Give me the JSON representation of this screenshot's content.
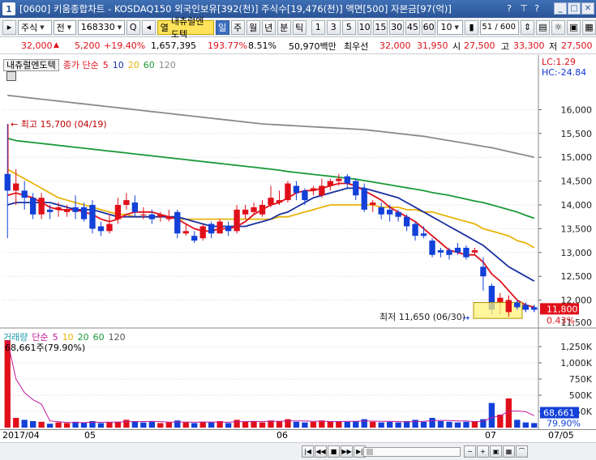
{
  "window": {
    "number": "1",
    "title": "[0600] 키움종합차트 - KOSDAQ150 외국인보유[392(천)] 주식수[19,476(천)] 액면[500] 자본금[97(억)]"
  },
  "toolbar": {
    "market": "주식",
    "scope": "전",
    "code": "168330",
    "stock_name": "내츄럴엔도텍",
    "periods": [
      "일",
      "주",
      "월",
      "년",
      "분",
      "틱"
    ],
    "active_period": "일",
    "minutes": [
      "1",
      "3",
      "5",
      "10",
      "15",
      "30",
      "45",
      "60"
    ],
    "count_value": "10",
    "page_counter": "51 / 600"
  },
  "price_strip": {
    "price": "32,000",
    "change": "5,200",
    "change_pct": "+19.40%",
    "volume": "1,657,395",
    "vol_ratio": "193.77%",
    "turnover": "8.51%",
    "amount": "50,970백만",
    "best_ask_label": "최우선",
    "best_ask": "32,000",
    "best_bid": "31,950",
    "open_label": "시",
    "open": "27,500",
    "high_label": "고",
    "high": "33,300",
    "low_label": "저",
    "low": "27,500"
  },
  "price_legend": {
    "stock_name": "내츄럴엔도텍",
    "ma_label": "종가 단순",
    "ma_periods": [
      "5",
      "10",
      "20",
      "60",
      "120"
    ],
    "lc": "LC:1.29",
    "hc": "HC:-24.84"
  },
  "volume_legend": {
    "label": "거래량",
    "ma_label": "단순",
    "ma_periods": [
      "5",
      "10",
      "20",
      "60",
      "120"
    ],
    "value_text": "68,661주(79.90%)"
  },
  "annotations": {
    "high_label": "최고 15,700 (04/19)",
    "low_label": "최저 11,650 (06/30)",
    "current_price": "11,800",
    "current_pct": "0.43%",
    "current_volume": "68,661",
    "current_vol_pct": "79.90%"
  },
  "colors": {
    "up": "#e0101a",
    "down": "#1240d8",
    "ma5": "#e0101a",
    "ma10": "#1a2fa0",
    "ma20": "#e8b40c",
    "ma60": "#1a9a3a",
    "ma120": "#8a8a8a"
  },
  "time_axis": [
    "2017/04",
    "05",
    "06",
    "07",
    "07/05"
  ],
  "chart_data": [
    {
      "type": "candlestick",
      "title": "내츄럴엔도텍 일봉",
      "ylim": [
        11500,
        16500
      ],
      "y_ticks": [
        12000,
        12500,
        13000,
        13500,
        14000,
        14500,
        15000,
        15500,
        16000
      ],
      "y_tick_labels": [
        "12,000",
        "12,500",
        "13,000",
        "13,500",
        "14,000",
        "14,500",
        "15,000",
        "15,500",
        "16,000"
      ],
      "extra_tick_label": "11,500",
      "candles": [
        [
          14650,
          14300,
          15700,
          13300
        ],
        [
          14300,
          14450,
          14750,
          14000
        ],
        [
          14300,
          14150,
          14500,
          13900
        ],
        [
          14150,
          13800,
          14250,
          13700
        ],
        [
          13800,
          14150,
          14250,
          13700
        ],
        [
          13900,
          13850,
          14000,
          13700
        ],
        [
          13900,
          13950,
          14050,
          13750
        ],
        [
          13850,
          13900,
          14000,
          13750
        ],
        [
          13950,
          13850,
          14200,
          13700
        ],
        [
          13950,
          13700,
          14050,
          13650
        ],
        [
          14000,
          13500,
          14100,
          13400
        ],
        [
          13550,
          13450,
          13650,
          13350
        ],
        [
          13450,
          13600,
          13800,
          13400
        ],
        [
          13700,
          14000,
          14150,
          13600
        ],
        [
          14000,
          14100,
          14250,
          13900
        ],
        [
          14050,
          13850,
          14200,
          13750
        ],
        [
          13800,
          13800,
          13950,
          13700
        ],
        [
          13800,
          13700,
          13900,
          13600
        ],
        [
          13750,
          13800,
          13850,
          13650
        ],
        [
          13700,
          13750,
          13900,
          13650
        ],
        [
          13850,
          13400,
          13900,
          13300
        ],
        [
          13400,
          13450,
          13600,
          13350
        ],
        [
          13350,
          13250,
          13450,
          13200
        ],
        [
          13300,
          13550,
          13600,
          13250
        ],
        [
          13600,
          13400,
          13650,
          13300
        ],
        [
          13400,
          13650,
          13700,
          13400
        ],
        [
          13550,
          13450,
          13650,
          13350
        ],
        [
          13450,
          13900,
          14000,
          13400
        ],
        [
          13800,
          13900,
          14000,
          13700
        ],
        [
          13850,
          13950,
          14050,
          13800
        ],
        [
          13800,
          14000,
          14100,
          13750
        ],
        [
          14000,
          14150,
          14400,
          13950
        ],
        [
          14050,
          14100,
          14300,
          14000
        ],
        [
          14100,
          14450,
          14500,
          14050
        ],
        [
          14400,
          14250,
          14500,
          14100
        ],
        [
          14300,
          14100,
          14350,
          14000
        ],
        [
          14300,
          14350,
          14400,
          14200
        ],
        [
          14200,
          14400,
          14550,
          14150
        ],
        [
          14400,
          14500,
          14550,
          14300
        ],
        [
          14500,
          14550,
          14650,
          14400
        ],
        [
          14600,
          14450,
          14650,
          14350
        ],
        [
          14500,
          14200,
          14550,
          14100
        ],
        [
          14350,
          13900,
          14450,
          13850
        ],
        [
          14000,
          14050,
          14100,
          13850
        ],
        [
          13950,
          13800,
          14050,
          13700
        ],
        [
          13900,
          13800,
          14000,
          13650
        ],
        [
          13850,
          13750,
          13900,
          13650
        ],
        [
          13750,
          13550,
          13800,
          13450
        ],
        [
          13600,
          13350,
          13650,
          13250
        ],
        [
          13400,
          13350,
          13550,
          13300
        ],
        [
          13250,
          12950,
          13300,
          12900
        ],
        [
          13050,
          13000,
          13100,
          12900
        ],
        [
          13050,
          12950,
          13100,
          12850
        ],
        [
          13100,
          13000,
          13200,
          12950
        ],
        [
          13100,
          12900,
          13150,
          12850
        ],
        [
          13000,
          13050,
          13100,
          12950
        ],
        [
          12700,
          12500,
          12900,
          12200
        ],
        [
          12300,
          11800,
          12350,
          11700
        ],
        [
          11950,
          12050,
          12150,
          11700
        ],
        [
          11750,
          12000,
          12100,
          11650
        ],
        [
          11950,
          11850,
          12000,
          11800
        ],
        [
          11900,
          11800,
          11950,
          11750
        ],
        [
          11850,
          11800,
          11900,
          11750
        ]
      ],
      "moving_averages": {
        "ma5": [
          14200,
          14250,
          14200,
          14150,
          14050,
          13950,
          13900,
          13900,
          13900,
          13850,
          13800,
          13700,
          13650,
          13700,
          13800,
          13850,
          13850,
          13850,
          13800,
          13750,
          13700,
          13600,
          13500,
          13450,
          13450,
          13500,
          13500,
          13550,
          13650,
          13800,
          13900,
          14000,
          14050,
          14150,
          14250,
          14300,
          14300,
          14350,
          14400,
          14450,
          14450,
          14400,
          14300,
          14200,
          14100,
          13950,
          13850,
          13750,
          13650,
          13500,
          13350,
          13200,
          13050,
          13000,
          12950,
          12950,
          12800,
          12550,
          12400,
          12200,
          12000,
          11900,
          11850
        ],
        "ma10": [
          14000,
          14050,
          14050,
          14050,
          14050,
          14050,
          14000,
          13950,
          13900,
          13900,
          13900,
          13850,
          13800,
          13750,
          13750,
          13750,
          13750,
          13750,
          13750,
          13750,
          13750,
          13700,
          13650,
          13600,
          13550,
          13550,
          13550,
          13550,
          13550,
          13600,
          13650,
          13700,
          13800,
          13850,
          13950,
          14050,
          14150,
          14200,
          14250,
          14300,
          14350,
          14350,
          14350,
          14300,
          14250,
          14200,
          14150,
          14050,
          13950,
          13850,
          13750,
          13650,
          13550,
          13450,
          13350,
          13250,
          13150,
          13000,
          12850,
          12700,
          12600,
          12500,
          12400
        ],
        "ma20": [
          14750,
          14650,
          14550,
          14450,
          14350,
          14250,
          14150,
          14100,
          14050,
          14000,
          13950,
          13900,
          13850,
          13800,
          13800,
          13750,
          13750,
          13750,
          13750,
          13750,
          13700,
          13700,
          13700,
          13700,
          13700,
          13700,
          13700,
          13700,
          13700,
          13700,
          13700,
          13700,
          13750,
          13750,
          13800,
          13850,
          13900,
          13950,
          14000,
          14000,
          14000,
          14000,
          14000,
          14000,
          13950,
          13950,
          13950,
          13900,
          13900,
          13850,
          13850,
          13800,
          13750,
          13700,
          13650,
          13600,
          13500,
          13450,
          13400,
          13350,
          13250,
          13200,
          13100
        ],
        "ma60": [
          15400,
          15350,
          15330,
          15310,
          15290,
          15270,
          15250,
          15230,
          15210,
          15190,
          15170,
          15150,
          15130,
          15110,
          15090,
          15070,
          15050,
          15030,
          15010,
          14990,
          14970,
          14950,
          14930,
          14910,
          14890,
          14870,
          14850,
          14830,
          14810,
          14790,
          14770,
          14750,
          14730,
          14700,
          14680,
          14660,
          14640,
          14620,
          14600,
          14580,
          14560,
          14540,
          14510,
          14480,
          14450,
          14420,
          14390,
          14360,
          14330,
          14300,
          14260,
          14230,
          14200,
          14160,
          14120,
          14080,
          14050,
          14000,
          13950,
          13900,
          13850,
          13780,
          13720
        ],
        "ma120": [
          16300,
          16280,
          16260,
          16240,
          16220,
          16200,
          16180,
          16160,
          16140,
          16120,
          16100,
          16080,
          16060,
          16040,
          16020,
          16000,
          15980,
          15960,
          15940,
          15920,
          15900,
          15880,
          15860,
          15840,
          15820,
          15800,
          15780,
          15760,
          15740,
          15720,
          15700,
          15690,
          15680,
          15670,
          15660,
          15650,
          15640,
          15630,
          15620,
          15610,
          15600,
          15590,
          15580,
          15560,
          15540,
          15520,
          15500,
          15480,
          15460,
          15440,
          15410,
          15380,
          15350,
          15320,
          15290,
          15260,
          15230,
          15200,
          15160,
          15120,
          15080,
          15040,
          15000
        ]
      }
    },
    {
      "type": "bar",
      "title": "거래량",
      "ylim": [
        0,
        1400000
      ],
      "y_ticks": [
        250000,
        500000,
        750000,
        1000000,
        1250000
      ],
      "y_tick_labels": [
        "250K",
        "500K",
        "750K",
        "1,000K",
        "1,250K"
      ],
      "values": [
        1350000,
        150000,
        120000,
        100000,
        90000,
        60000,
        80000,
        70000,
        90000,
        80000,
        100000,
        70000,
        80000,
        90000,
        120000,
        100000,
        80000,
        90000,
        70000,
        80000,
        110000,
        80000,
        70000,
        90000,
        80000,
        100000,
        70000,
        120000,
        90000,
        100000,
        80000,
        110000,
        100000,
        130000,
        90000,
        80000,
        90000,
        110000,
        100000,
        90000,
        90000,
        100000,
        130000,
        90000,
        80000,
        90000,
        80000,
        100000,
        120000,
        90000,
        150000,
        100000,
        90000,
        80000,
        90000,
        100000,
        130000,
        380000,
        200000,
        450000,
        120000,
        80000,
        70000
      ],
      "up": [
        1,
        1,
        0,
        0,
        1,
        0,
        1,
        1,
        0,
        0,
        0,
        0,
        1,
        1,
        1,
        0,
        0,
        0,
        1,
        1,
        0,
        1,
        0,
        1,
        0,
        1,
        0,
        1,
        1,
        1,
        1,
        1,
        1,
        1,
        0,
        0,
        1,
        1,
        1,
        1,
        0,
        0,
        0,
        1,
        0,
        0,
        0,
        0,
        0,
        0,
        0,
        0,
        0,
        0,
        0,
        1,
        0,
        0,
        1,
        1,
        0,
        0,
        0
      ]
    }
  ]
}
